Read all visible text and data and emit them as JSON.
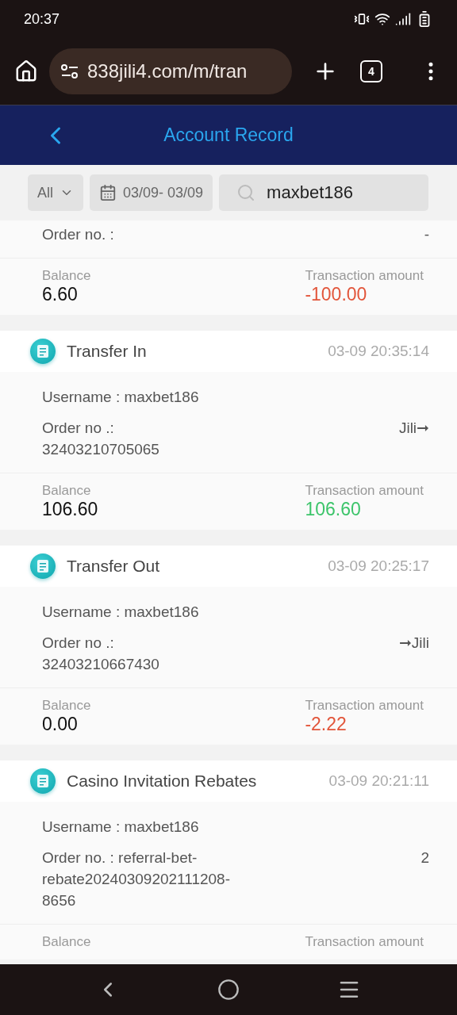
{
  "status_bar": {
    "time": "20:37"
  },
  "browser": {
    "url": "838jili4.com/m/tran",
    "tab_count": "4"
  },
  "header": {
    "title": "Account Record"
  },
  "filters": {
    "type": "All",
    "date_range": "03/09- 03/09",
    "search": "maxbet186"
  },
  "records": [
    {
      "partial": true,
      "order": "Order no. :",
      "order_target": "-",
      "balance_label": "Balance",
      "balance": "6.60",
      "amount_label": "Transaction amount",
      "amount": "-100.00",
      "color": "#e2553a"
    },
    {
      "partial": false,
      "type": "Transfer In",
      "time": "03-09 20:35:14",
      "username": "Username : maxbet186",
      "order": "Order no .:\n32403210705065",
      "order_target": "Jili➞",
      "balance_label": "Balance",
      "balance": "106.60",
      "amount_label": "Transaction amount",
      "amount": "106.60",
      "color": "#3cc46a"
    },
    {
      "partial": false,
      "type": "Transfer Out",
      "time": "03-09 20:25:17",
      "username": "Username : maxbet186",
      "order": "Order no .:\n32403210667430",
      "order_target": "➞Jili",
      "balance_label": "Balance",
      "balance": "0.00",
      "amount_label": "Transaction amount",
      "amount": "-2.22",
      "color": "#e2553a"
    },
    {
      "partial": false,
      "type": "Casino Invitation Rebates",
      "time": "03-09 20:21:11",
      "username": "Username : maxbet186",
      "order": "Order no. : referral-bet-\nrebate20240309202111208-\n8656",
      "order_target": "2",
      "balance_label": "Balance",
      "amount_label": "Transaction amount"
    }
  ]
}
